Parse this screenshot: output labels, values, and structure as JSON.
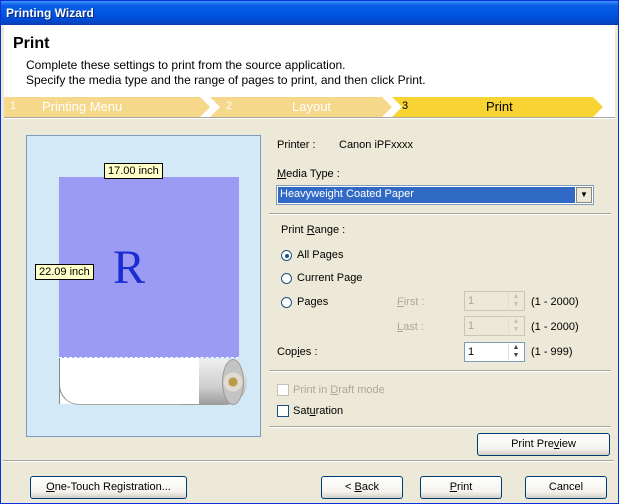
{
  "window": {
    "title": "Printing Wizard"
  },
  "header": {
    "title": "Print",
    "line1": "Complete these settings to print from the source application.",
    "line2": "Specify the media type and the range of pages to print, and then click Print."
  },
  "steps": [
    {
      "num": "1",
      "label": "Printing Menu",
      "state": "done"
    },
    {
      "num": "2",
      "label": "Layout",
      "state": "done"
    },
    {
      "num": "3",
      "label": "Print",
      "state": "active"
    }
  ],
  "preview": {
    "width_label": "17.00 inch",
    "height_label": "22.09 inch",
    "letter": "R"
  },
  "printer": {
    "label": "Printer :",
    "name": "Canon iPFxxxx"
  },
  "media": {
    "label_prefix": "",
    "label_accel": "M",
    "label_rest": "edia Type :",
    "value": "Heavyweight Coated Paper"
  },
  "range": {
    "label_prefix": "Print ",
    "label_accel": "R",
    "label_rest": "ange :",
    "options": [
      {
        "label": "All Pages",
        "selected": true
      },
      {
        "label": "Current Page",
        "selected": false
      },
      {
        "label": "Pages",
        "selected": false
      }
    ],
    "first": {
      "accel": "F",
      "rest": "irst :",
      "value": "1",
      "range": "(1 - 2000)"
    },
    "last": {
      "accel": "L",
      "rest": "ast :",
      "value": "1",
      "range": "(1 - 2000)"
    }
  },
  "copies": {
    "label_prefix": "Cop",
    "label_accel": "i",
    "label_rest": "es :",
    "value": "1",
    "range": "(1 - 999)"
  },
  "draft": {
    "label_prefix": "Print in ",
    "label_accel": "D",
    "label_rest": "raft mode",
    "checked": false,
    "enabled": false
  },
  "saturation": {
    "label_prefix": "Sat",
    "label_accel": "u",
    "label_rest": "ration",
    "checked": false
  },
  "buttons": {
    "preview": {
      "prefix": "Print Pre",
      "accel": "v",
      "rest": "iew"
    },
    "one_touch": {
      "prefix": "",
      "accel": "O",
      "rest": "ne-Touch Registration..."
    },
    "back": {
      "prefix": "< ",
      "accel": "B",
      "rest": "ack"
    },
    "print": {
      "prefix": "",
      "accel": "P",
      "rest": "rint"
    },
    "cancel": "Cancel"
  }
}
